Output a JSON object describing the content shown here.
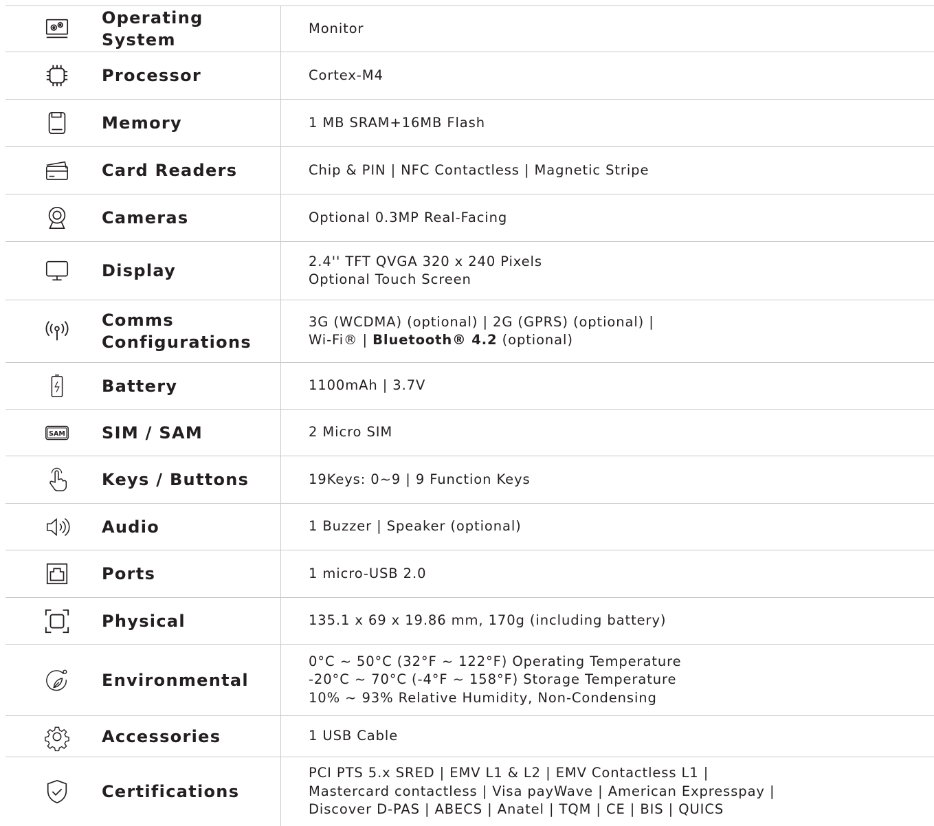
{
  "rows": [
    {
      "icon": "operating-system-icon",
      "label": "Operating System",
      "lines": [
        "Monitor"
      ]
    },
    {
      "icon": "processor-chip-icon",
      "label": "Processor",
      "lines": [
        "Cortex-M4"
      ]
    },
    {
      "icon": "memory-card-icon",
      "label": "Memory",
      "lines": [
        "1 MB SRAM+16MB Flash"
      ]
    },
    {
      "icon": "card-reader-icon",
      "label": "Card Readers",
      "lines": [
        "Chip & PIN | NFC Contactless | Magnetic Stripe"
      ]
    },
    {
      "icon": "camera-webcam-icon",
      "label": "Cameras",
      "lines": [
        "Optional 0.3MP Real-Facing"
      ]
    },
    {
      "icon": "display-monitor-icon",
      "label": "Display",
      "lines": [
        "2.4'' TFT QVGA 320 x 240 Pixels",
        "Optional Touch Screen"
      ]
    },
    {
      "icon": "antenna-signal-icon",
      "label": "Comms Configurations",
      "lines": [
        "3G (WCDMA) (optional) | 2G (GPRS) (optional) |",
        "Wi-Fi® | "
      ],
      "bold": "Bluetooth® 4.2",
      "suffix": " (optional)"
    },
    {
      "icon": "battery-icon",
      "label": "Battery",
      "lines": [
        "1100mAh | 3.7V"
      ]
    },
    {
      "icon": "sam-chip-icon",
      "label": "SIM / SAM",
      "lines": [
        "2 Micro SIM"
      ]
    },
    {
      "icon": "touch-hand-icon",
      "label": "Keys / Buttons",
      "lines": [
        "19Keys: 0~9 | 9 Function Keys"
      ]
    },
    {
      "icon": "speaker-icon",
      "label": "Audio",
      "lines": [
        "1 Buzzer | Speaker (optional)"
      ]
    },
    {
      "icon": "port-ethernet-icon",
      "label": "Ports",
      "lines": [
        "1 micro-USB 2.0"
      ]
    },
    {
      "icon": "dimensions-frame-icon",
      "label": "Physical",
      "lines": [
        "135.1 x 69 x 19.86 mm, 170g (including battery)"
      ]
    },
    {
      "icon": "leaf-globe-icon",
      "label": "Environmental",
      "lines": [
        "0°C ~ 50°C (32°F ~ 122°F) Operating Temperature",
        "-20°C ~ 70°C (-4°F ~ 158°F) Storage Temperature",
        "10% ~ 93% Relative Humidity, Non-Condensing"
      ]
    },
    {
      "icon": "gear-icon",
      "label": "Accessories",
      "lines": [
        "1 USB Cable"
      ]
    },
    {
      "icon": "shield-check-icon",
      "label": "Certifications",
      "lines": [
        "PCI PTS 5.x SRED | EMV L1 & L2 | EMV Contactless L1 |",
        "Mastercard contactless | Visa payWave | American Expresspay |",
        "Discover D-PAS | ABECS | Anatel | TQM | CE | BIS | QUICS"
      ]
    }
  ]
}
